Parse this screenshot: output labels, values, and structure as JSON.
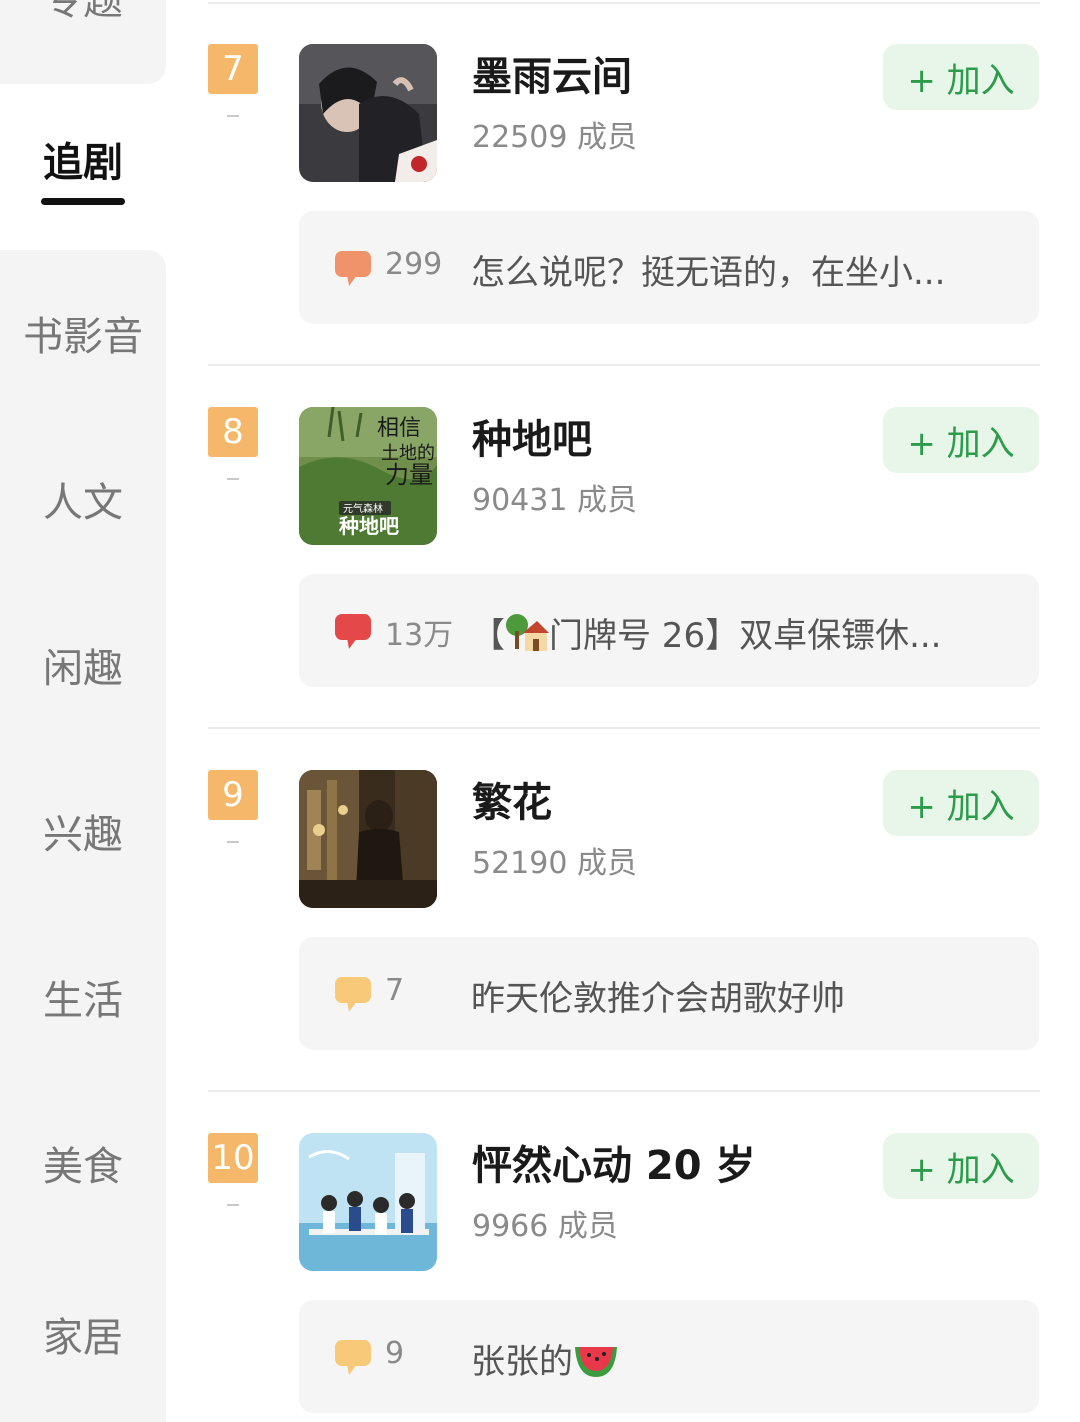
{
  "sidebar": {
    "items": [
      {
        "label": "专题",
        "active": false
      },
      {
        "label": "追剧",
        "active": true
      },
      {
        "label": "书影音",
        "active": false
      },
      {
        "label": "人文",
        "active": false
      },
      {
        "label": "闲趣",
        "active": false
      },
      {
        "label": "兴趣",
        "active": false
      },
      {
        "label": "生活",
        "active": false
      },
      {
        "label": "美食",
        "active": false
      },
      {
        "label": "家居",
        "active": false
      }
    ]
  },
  "groups": [
    {
      "rank": "7",
      "title": "墨雨云间",
      "members": "22509 成员",
      "join_label": "+ 加入",
      "post": {
        "count": "299",
        "text": "怎么说呢？挺无语的，在坐小...",
        "bubble_color": "#f0926a"
      }
    },
    {
      "rank": "8",
      "title": "种地吧",
      "members": "90431 成员",
      "join_label": "+ 加入",
      "post": {
        "count": "13万",
        "text_prefix": "【",
        "text": "门牌号 26】双卓保镖休...",
        "bubble_color": "#e54848"
      }
    },
    {
      "rank": "9",
      "title": "繁花",
      "members": "52190 成员",
      "join_label": "+ 加入",
      "post": {
        "count": "7",
        "text": "昨天伦敦推介会胡歌好帅",
        "bubble_color": "#f7c978"
      }
    },
    {
      "rank": "10",
      "title": "怦然心动 20 岁",
      "members": "9966 成员",
      "join_label": "+ 加入",
      "post": {
        "count": "9",
        "text": "张张的",
        "bubble_color": "#f7c978"
      }
    }
  ],
  "colors": {
    "rank_badge": "#f5b86a",
    "join_bg": "#e8f6ea",
    "join_text": "#2c9c4a",
    "post_bg": "#f5f5f5"
  },
  "icons": {
    "comment": "speech-bubble-icon",
    "house": "house-tree-emoji-icon",
    "watermelon": "watermelon-emoji-icon"
  }
}
